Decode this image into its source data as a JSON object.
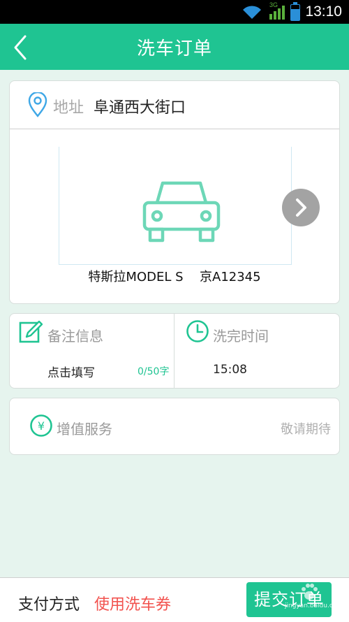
{
  "status_bar": {
    "time": "13:10",
    "network": "3G"
  },
  "header": {
    "title": "洗车订单"
  },
  "address": {
    "label": "地址",
    "value": "阜通西大街口"
  },
  "vehicle": {
    "model": "特斯拉MODEL S",
    "plate": "京A12345"
  },
  "note": {
    "label": "备注信息",
    "placeholder": "点击填写",
    "count": "0/50字"
  },
  "wash_time": {
    "label": "洗完时间",
    "value": "15:08"
  },
  "value_added": {
    "label": "增值服务",
    "status": "敬请期待"
  },
  "footer": {
    "pay_label": "支付方式",
    "pay_method": "使用洗车券",
    "submit_label": "提交订单",
    "watermark": "jingyan.baidu.com"
  },
  "colors": {
    "accent": "#1fc492",
    "pay_method": "#f2524e",
    "background": "#e6f4ee"
  },
  "icons": [
    "back-arrow-icon",
    "location-pin-icon",
    "car-icon",
    "chevron-right-icon",
    "edit-note-icon",
    "clock-icon",
    "yen-icon",
    "wifi-icon",
    "signal-icon",
    "battery-icon"
  ]
}
